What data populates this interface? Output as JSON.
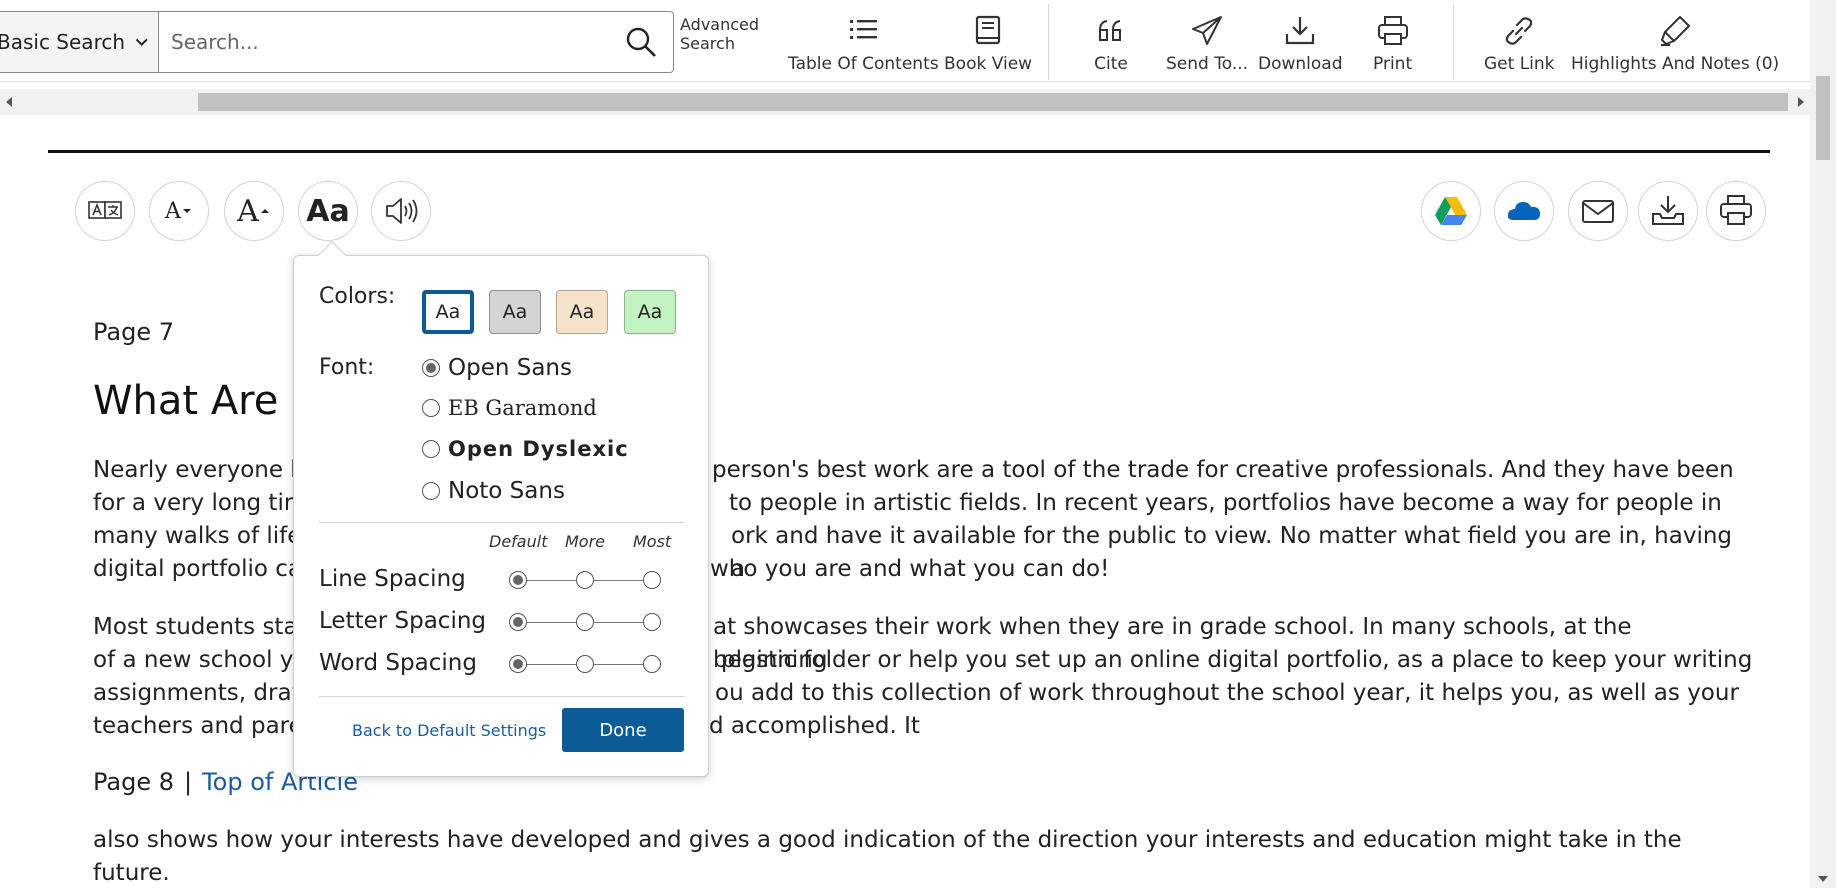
{
  "toolbar": {
    "search_type": "Basic Search",
    "search_placeholder": "Search...",
    "advanced_search_line1": "Advanced",
    "advanced_search_line2": "Search",
    "table_of_contents": "Table Of Contents",
    "book_view": "Book View",
    "cite": "Cite",
    "send_to": "Send To...",
    "download": "Download",
    "print": "Print",
    "get_link": "Get Link",
    "highlights_notes": "Highlights And Notes (0)"
  },
  "reader_tools": {
    "font_smaller": "A",
    "font_larger": "A",
    "display_settings": "Aa"
  },
  "article": {
    "page7": "Page 7",
    "title": "What Are D",
    "para1_lines": [
      "Nearly everyone k",
      "for a very long tim",
      "many walks of life",
      "digital portfolio ca"
    ],
    "para1_right": [
      "person's best work are a tool of the trade for creative professionals. And they have been",
      "to people in artistic fields. In recent years, portfolios have become a way for people in",
      "ork and have it available for the public to view. No matter what field you are in, having a",
      "who you are and what you can do!"
    ],
    "para2_lines": [
      "Most students sta",
      "of a new school ye",
      "assignments, draw",
      "teachers and pare"
    ],
    "para2_right": [
      "at showcases their work when they are in grade school. In many schools, at the beginning",
      "plastic folder or help you set up an online digital portfolio, as a place to keep your writing",
      "ou add to this collection of work throughout the school year, it helps you, as well as your",
      "d accomplished. It"
    ],
    "page8": "Page 8",
    "separator": "|",
    "top_link": "Top of Article",
    "para3": "also shows how your interests have developed and gives a good indication of the direction your interests and education might take in the future."
  },
  "settings": {
    "colors_label": "Colors:",
    "swatches": [
      {
        "text": "Aa",
        "bg": "#ffffff",
        "border": "#0d5b96"
      },
      {
        "text": "Aa",
        "bg": "#d4d4d4",
        "border": "#8f8f8f"
      },
      {
        "text": "Aa",
        "bg": "#f6e3cc",
        "border": "#b9a48a"
      },
      {
        "text": "Aa",
        "bg": "#c3f2c3",
        "border": "#80b880"
      }
    ],
    "font_label": "Font:",
    "fonts": [
      {
        "name": "Open Sans",
        "selected": true
      },
      {
        "name": "EB Garamond",
        "selected": false
      },
      {
        "name": "Open Dyslexic",
        "selected": false
      },
      {
        "name": "Noto Sans",
        "selected": false
      }
    ],
    "scale": [
      "Default",
      "More",
      "Most"
    ],
    "line_spacing": "Line Spacing",
    "letter_spacing": "Letter Spacing",
    "word_spacing": "Word Spacing",
    "spacing_selected": "Default",
    "reset": "Back to Default Settings",
    "done": "Done"
  }
}
